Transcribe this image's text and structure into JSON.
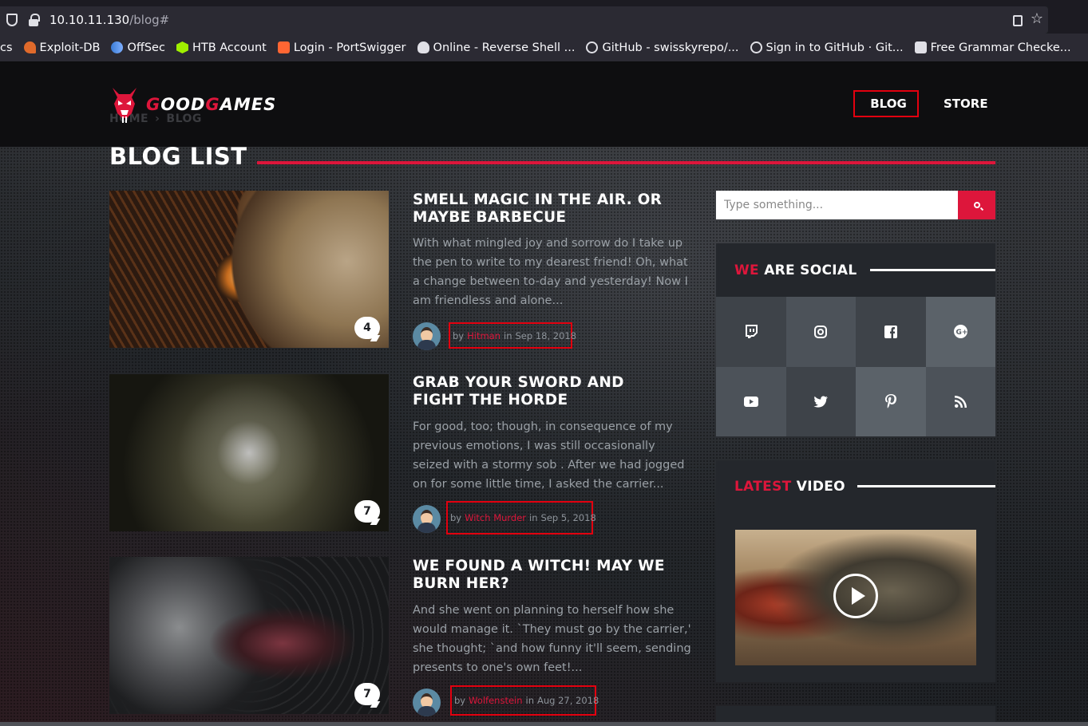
{
  "browser": {
    "url_host": "10.10.11.130",
    "url_path": "/blog#",
    "bookmarks": [
      {
        "label": "cs",
        "icon": "none",
        "color": ""
      },
      {
        "label": "Exploit-DB",
        "icon": "exploitdb-icon",
        "color": "#e06a2b"
      },
      {
        "label": "OffSec",
        "icon": "offsec-icon",
        "color": "#3a7bd5"
      },
      {
        "label": "HTB Account",
        "icon": "htb-icon",
        "color": "#9fef00"
      },
      {
        "label": "Login - PortSwigger",
        "icon": "portswigger-icon",
        "color": "#ff6633"
      },
      {
        "label": "Online - Reverse Shell ...",
        "icon": "skull-icon",
        "color": "#e0e0e6"
      },
      {
        "label": "GitHub - swisskyrepo/...",
        "icon": "github-icon",
        "color": "#e0e0e6"
      },
      {
        "label": "Sign in to GitHub · Git...",
        "icon": "github-icon",
        "color": "#e0e0e6"
      },
      {
        "label": "Free Grammar Checke...",
        "icon": "grammar-icon",
        "color": "#e0e0e6"
      }
    ]
  },
  "site": {
    "logo_g1": "G",
    "logo_mid": "OOD",
    "logo_g2": "G",
    "logo_end": "AMES",
    "breadcrumb_home": "HOME",
    "breadcrumb_sep": "›",
    "breadcrumb_blog": "BLOG",
    "nav_blog": "BLOG",
    "nav_store": "STORE",
    "accent_color": "#dd163b"
  },
  "page": {
    "title": "BLOG LIST"
  },
  "posts": [
    {
      "title": "SMELL MAGIC IN THE AIR. OR MAYBE BARBECUE",
      "excerpt": "With what mingled joy and sorrow do I take up the pen to write to my dearest friend! Oh, what a change between to-day and yesterday! Now I am friendless and alone...",
      "comments": "4",
      "by": "by",
      "author": "Hitman",
      "in": "in",
      "date": "Sep 18, 2018"
    },
    {
      "title": "GRAB YOUR SWORD AND FIGHT THE HORDE",
      "excerpt": "For good, too; though, in consequence of my previous emotions, I was still occasionally seized with a stormy sob . After we had jogged on for some little time, I asked the carrier...",
      "comments": "7",
      "by": "by",
      "author": "Witch Murder",
      "in": "in",
      "date": "Sep 5, 2018"
    },
    {
      "title": "WE FOUND A WITCH! MAY WE BURN HER?",
      "excerpt": "And she went on planning to herself how she would manage it. `They must go by the carrier,' she thought; `and how funny it'll seem, sending presents to one's own feet!...",
      "comments": "7",
      "by": "by",
      "author": "Wolfenstein",
      "in": "in",
      "date": "Aug 27, 2018"
    }
  ],
  "sidebar": {
    "search_placeholder": "Type something...",
    "social_title_accent": "WE",
    "social_title_rest": "ARE SOCIAL",
    "social_icons": [
      "twitch-icon",
      "instagram-icon",
      "facebook-icon",
      "google-plus-icon",
      "youtube-icon",
      "twitter-icon",
      "pinterest-icon",
      "rss-icon"
    ],
    "video_title_accent": "LATEST",
    "video_title_rest": "VIDEO"
  }
}
